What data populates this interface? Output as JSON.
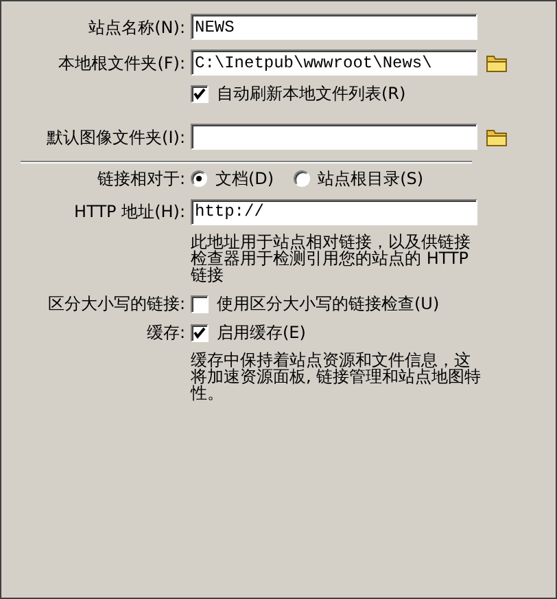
{
  "site_name": {
    "label": "站点名称(N):",
    "value": "NEWS"
  },
  "local_root": {
    "label": "本地根文件夹(F):",
    "value": "C:\\Inetpub\\wwwroot\\News\\"
  },
  "auto_refresh": {
    "label": "自动刷新本地文件列表(R)",
    "checked": true
  },
  "default_images": {
    "label": "默认图像文件夹(I):"
  },
  "links_relative": {
    "label": "链接相对于:",
    "options": [
      {
        "label": "文档(D)",
        "selected": true
      },
      {
        "label": "站点根目录(S)",
        "selected": false
      }
    ]
  },
  "http_address": {
    "label": "HTTP 地址(H):",
    "value": "http://",
    "help": "此地址用于站点相对链接，以及供链接检查器用于检测引用您的站点的 HTTP 链接"
  },
  "case_sensitive": {
    "label": "区分大小写的链接:",
    "checkbox": {
      "label": "使用区分大小写的链接检查(U)",
      "checked": false
    }
  },
  "cache": {
    "label": "缓存:",
    "checkbox": {
      "label": "启用缓存(E)",
      "checked": true
    },
    "help": "缓存中保持着站点资源和文件信息，这将加速资源面板, 链接管理和站点地图特性。"
  }
}
